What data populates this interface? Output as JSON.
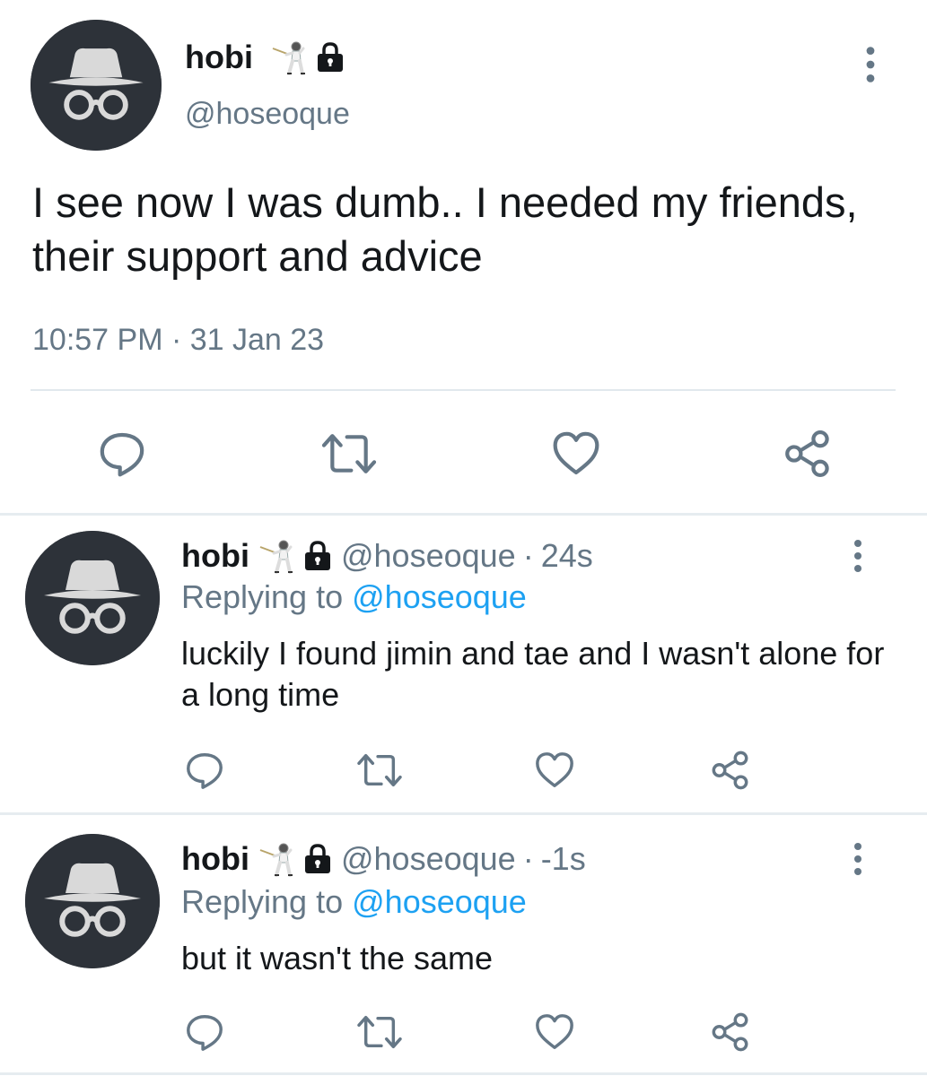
{
  "colors": {
    "text": "#14171a",
    "muted": "#657786",
    "accent": "#1da1f2",
    "icon": "#657786",
    "avatar_bg": "#2d3239",
    "divider": "#e6ecf0"
  },
  "main_tweet": {
    "display_name": "hobi",
    "handle": "@hoseoque",
    "text": "I see now I was dumb.. I needed my friends, their support and advice",
    "timestamp": "10:57 PM · 31 Jan 23",
    "icons": [
      "fencer-emoji-icon",
      "lock-icon",
      "more-vertical-icon",
      "reply-icon",
      "retweet-icon",
      "like-icon",
      "share-icon"
    ]
  },
  "replies": [
    {
      "display_name": "hobi",
      "handle": "@hoseoque",
      "separator": "·",
      "time": "24s",
      "replying_prefix": "Replying to",
      "replying_mention": "@hoseoque",
      "text": "luckily I found jimin and tae and I wasn't alone for a long time"
    },
    {
      "display_name": "hobi",
      "handle": "@hoseoque",
      "separator": "·",
      "time": "-1s",
      "replying_prefix": "Replying to",
      "replying_mention": "@hoseoque",
      "text": "but it wasn't the same"
    }
  ]
}
